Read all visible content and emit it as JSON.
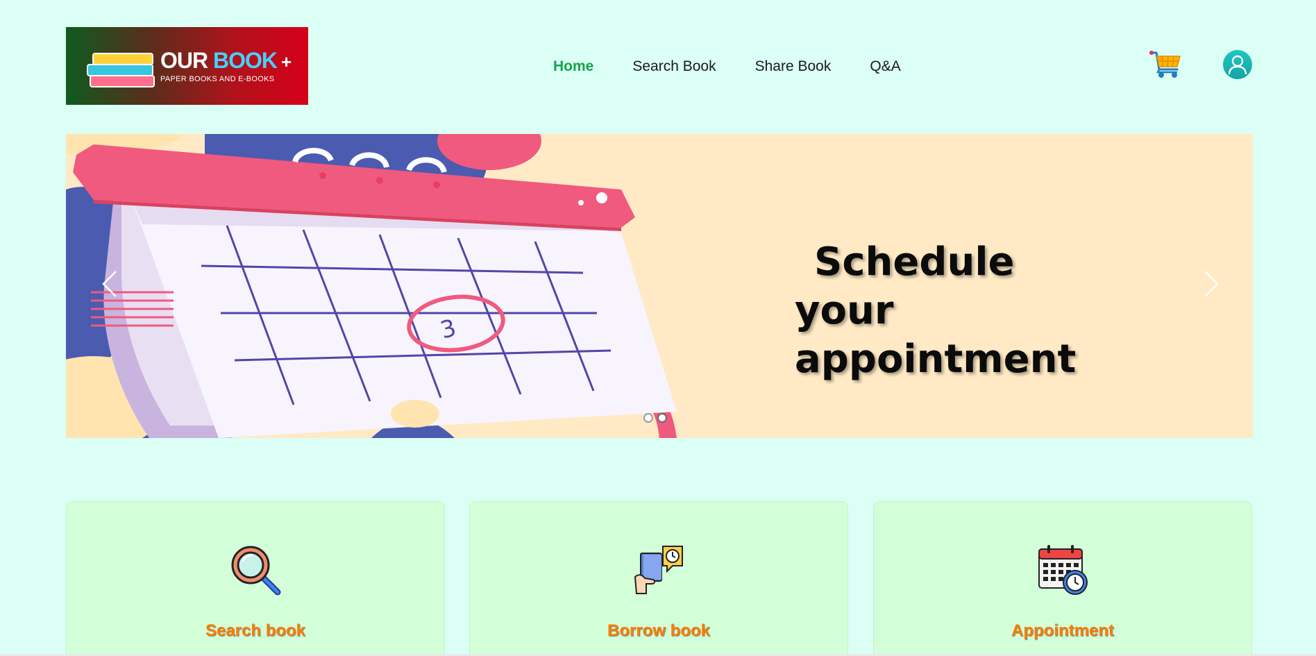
{
  "header": {
    "logo": {
      "title_our": "OUR",
      "title_book": "BOOK",
      "title_plus": "+",
      "subtitle": "PAPER BOOKS AND E-BOOKS"
    },
    "nav": [
      {
        "label": "Home",
        "active": true
      },
      {
        "label": "Search Book",
        "active": false
      },
      {
        "label": "Share Book",
        "active": false
      },
      {
        "label": "Q&A",
        "active": false
      }
    ],
    "icons": {
      "cart": "cart-icon",
      "account": "user-icon"
    },
    "colors": {
      "active_nav": "#16a34a",
      "page_background": "#dbfff5"
    }
  },
  "banner": {
    "line1": "Schedule",
    "line2": "your appointment",
    "calendar_date": "3",
    "slides_total": 2,
    "active_slide": 2,
    "background": "#ffeac5"
  },
  "services": [
    {
      "label": "Search book",
      "icon": "magnifier-icon"
    },
    {
      "label": "Borrow book",
      "icon": "borrow-book-icon"
    },
    {
      "label": "Appointment",
      "icon": "calendar-clock-icon"
    }
  ],
  "card_label_color": "#ff7a00"
}
